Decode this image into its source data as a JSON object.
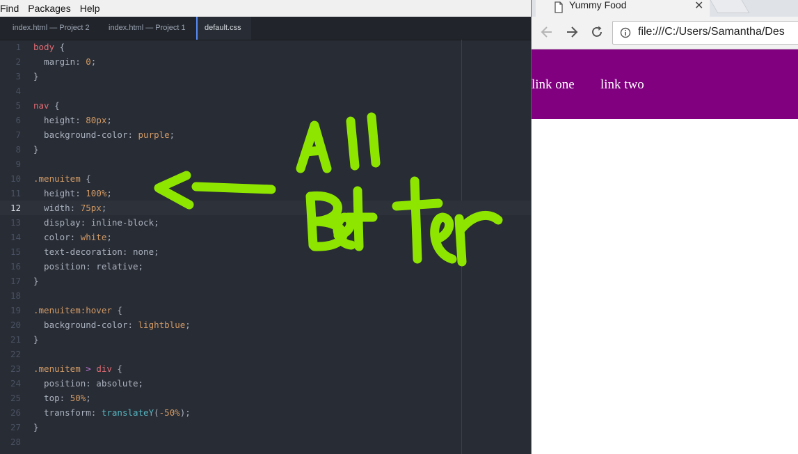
{
  "editor": {
    "menu": [
      "Find",
      "Packages",
      "Help"
    ],
    "tabs": [
      {
        "label": "index.html — Project 2",
        "active": false
      },
      {
        "label": "index.html — Project 1",
        "active": false
      },
      {
        "label": "default.css",
        "active": true
      }
    ],
    "current_line": 12,
    "annotation": {
      "line1": "All",
      "line2": "Better",
      "color": "#8ee600"
    }
  },
  "browser": {
    "tab_title": "Yummy Food",
    "url": "file:///C:/Users/Samantha/Des",
    "nav_color": "#800080",
    "links": [
      "link one",
      "link two"
    ]
  },
  "icons": [
    "document-icon",
    "close-icon",
    "back-icon",
    "forward-icon",
    "reload-icon",
    "info-icon",
    "arrow-annotation"
  ]
}
